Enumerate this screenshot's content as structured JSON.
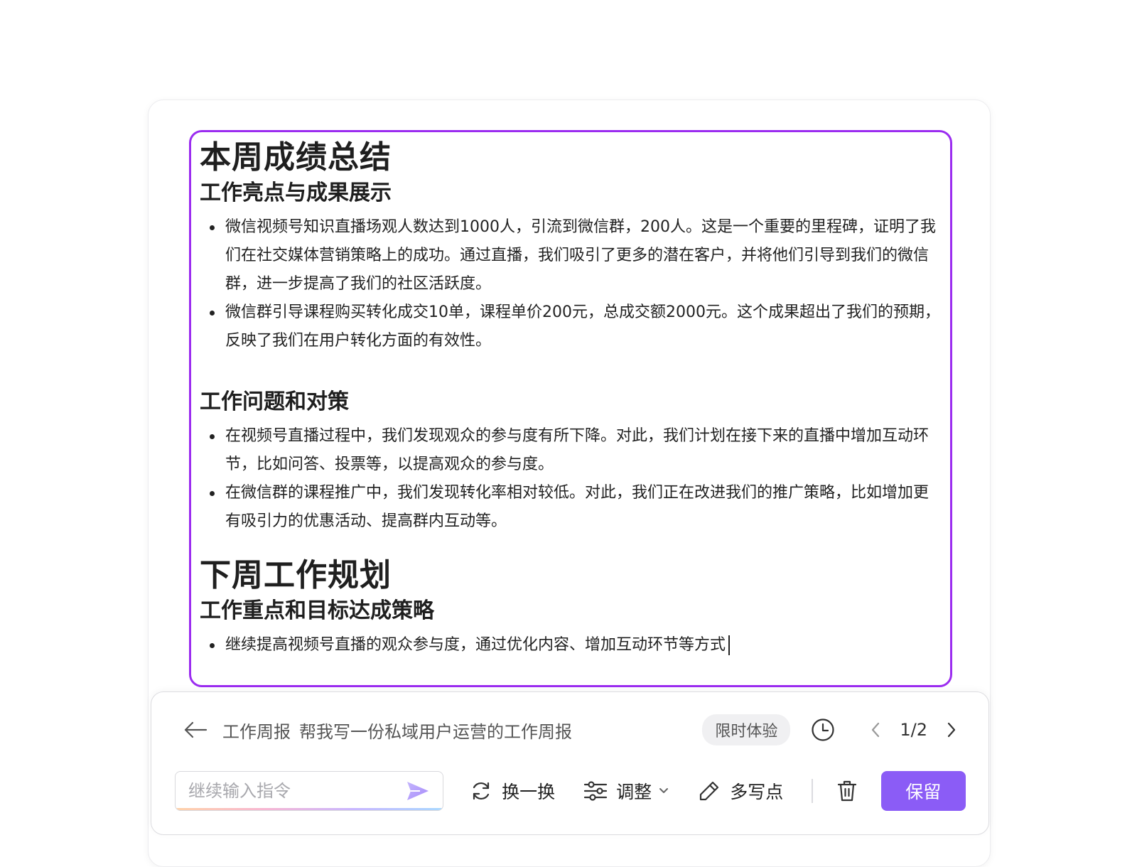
{
  "document": {
    "sections": [
      {
        "title": "本周成绩总结",
        "subsections": [
          {
            "title": "工作亮点与成果展示",
            "bullets": [
              "微信视频号知识直播场观人数达到1000人，引流到微信群，200人。这是一个重要的里程碑，证明了我们在社交媒体营销策略上的成功。通过直播，我们吸引了更多的潜在客户，并将他们引导到我们的微信群，进一步提高了我们的社区活跃度。",
              "微信群引导课程购买转化成交10单，课程单价200元，总成交额2000元。这个成果超出了我们的预期，反映了我们在用户转化方面的有效性。"
            ]
          },
          {
            "title": "工作问题和对策",
            "bullets": [
              "在视频号直播过程中，我们发现观众的参与度有所下降。对此，我们计划在接下来的直播中增加互动环节，比如问答、投票等，以提高观众的参与度。",
              "在微信群的课程推广中，我们发现转化率相对较低。对此，我们正在改进我们的推广策略，比如增加更有吸引力的优惠活动、提高群内互动等。"
            ]
          }
        ]
      },
      {
        "title": "下周工作规划",
        "subsections": [
          {
            "title": "工作重点和目标达成策略",
            "bullets": [
              "继续提高视频号直播的观众参与度，通过优化内容、增加互动环节等方式"
            ]
          }
        ]
      }
    ]
  },
  "panel": {
    "category": "工作周报",
    "prompt": "帮我写一份私域用户运营的工作周报",
    "badge": "限时体验",
    "pager": "1/2",
    "input": {
      "placeholder": "继续输入指令",
      "value": ""
    },
    "actions": {
      "regenerate": "换一换",
      "adjust": "调整",
      "expand": "多写点",
      "keep": "保留"
    }
  },
  "colors": {
    "accent": "#8b5cf6",
    "frame": "#9b2cf0"
  },
  "icons": [
    "back-arrow-icon",
    "clock-icon",
    "chevron-left-icon",
    "chevron-right-icon",
    "send-icon",
    "refresh-icon",
    "sliders-icon",
    "chevron-down-icon",
    "pencil-icon",
    "trash-icon"
  ]
}
